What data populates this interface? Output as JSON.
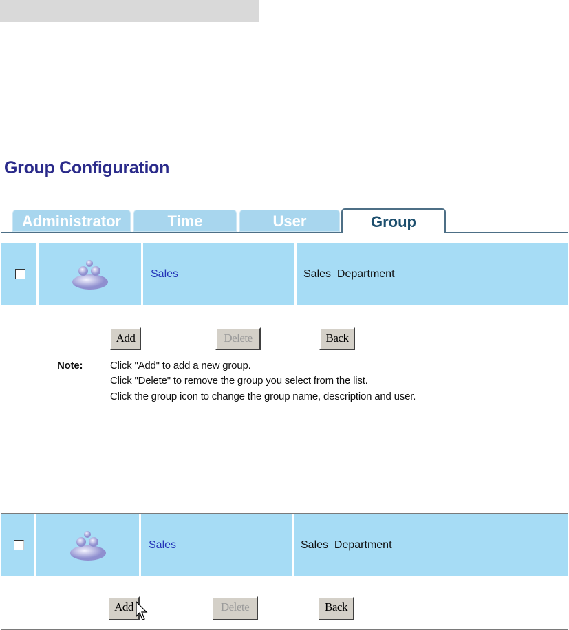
{
  "page_title": "Group Configuration",
  "tabs": [
    {
      "label": "Administrator"
    },
    {
      "label": "Time"
    },
    {
      "label": "User"
    },
    {
      "label": "Group",
      "active": true
    }
  ],
  "group_row": {
    "checked": false,
    "icon": "group-icon",
    "name": "Sales",
    "description": "Sales_Department"
  },
  "buttons": {
    "add": "Add",
    "delete": "Delete",
    "back": "Back"
  },
  "note": {
    "label": "Note:",
    "lines": [
      "Click \"Add\" to add a new group.",
      "Click \"Delete\" to remove the group you select from the list.",
      "Click the group icon to change the group name, description and user."
    ]
  },
  "colors": {
    "title": "#2a2a8a",
    "row_bg": "#a6dcf5",
    "tab_bg": "#a8d6ee",
    "link": "#2433b8"
  }
}
